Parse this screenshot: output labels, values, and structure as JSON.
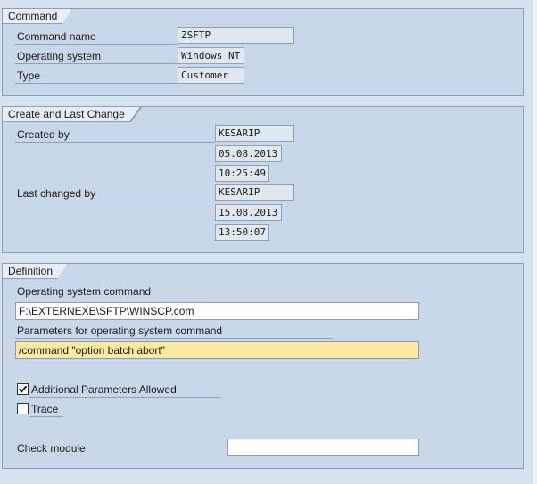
{
  "command": {
    "title": "Command",
    "name_label": "Command name",
    "name_value": "ZSFTP",
    "os_label": "Operating system",
    "os_value": "Windows NT",
    "type_label": "Type",
    "type_value": "Customer"
  },
  "change": {
    "title": "Create and Last Change",
    "created_by_label": "Created by",
    "created_by_value": "KESARIP",
    "created_date": "05.08.2013",
    "created_time": "10:25:49",
    "changed_by_label": "Last changed by",
    "changed_by_value": "KESARIP",
    "changed_date": "15.08.2013",
    "changed_time": "13:50:07"
  },
  "definition": {
    "title": "Definition",
    "os_command_label": "Operating system command",
    "os_command_value": "F:\\EXTERNEXE\\SFTP\\WINSCP.com",
    "params_label": "Parameters for operating system command",
    "params_value": "/command \"option batch abort\"",
    "additional_params_label": "Additional Parameters Allowed",
    "additional_params_checked": true,
    "trace_label": "Trace",
    "trace_checked": false,
    "check_module_label": "Check module",
    "check_module_value": ""
  },
  "colors": {
    "group_bg": "#c9d8e8",
    "highlight_field": "#fdeaa0"
  }
}
